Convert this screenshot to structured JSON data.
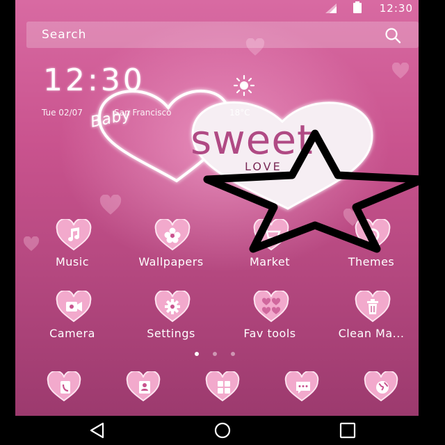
{
  "status_bar": {
    "time": "12:30"
  },
  "search": {
    "placeholder": "Search"
  },
  "clock_widget": {
    "time": "12:30",
    "date": "Tue  02/07",
    "location": "San Francisco",
    "temperature": "18°C"
  },
  "wallpaper": {
    "text_baby": "Baby",
    "text_sweet": "sweet",
    "text_love": "LOVE"
  },
  "apps_row1": [
    {
      "label": "Music",
      "icon": "music-note-icon"
    },
    {
      "label": "Wallpapers",
      "icon": "flower-icon"
    },
    {
      "label": "Market",
      "icon": "cart-icon"
    },
    {
      "label": "Themes",
      "icon": "themes-icon"
    }
  ],
  "apps_row2": [
    {
      "label": "Camera",
      "icon": "camera-icon"
    },
    {
      "label": "Settings",
      "icon": "gear-icon"
    },
    {
      "label": "Fav tools",
      "icon": "fav-tools-icon"
    },
    {
      "label": "Clean Ma...",
      "icon": "trash-icon"
    }
  ],
  "dock": [
    {
      "icon": "phone-icon"
    },
    {
      "icon": "contacts-icon"
    },
    {
      "icon": "apps-grid-icon"
    },
    {
      "icon": "message-icon"
    },
    {
      "icon": "globe-icon"
    }
  ],
  "page_indicator": {
    "pages": 3,
    "active": 0
  },
  "colors": {
    "wallpaper_top": "#d86aa2",
    "wallpaper_bottom": "#9c3a6e",
    "heart_icon": "#f2a9cc",
    "text": "#ffffff"
  },
  "overlay": {
    "icon": "star-outline-icon"
  }
}
